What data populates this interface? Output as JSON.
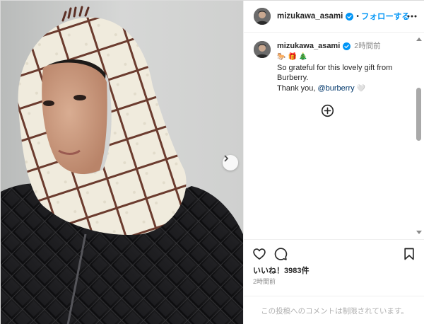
{
  "post": {
    "username": "mizukawa_asami",
    "follow_label": "フォローする",
    "separator": "•",
    "caption": {
      "emojis": [
        "🐎",
        "🎁",
        "🎄"
      ],
      "time": "2時間前",
      "line1": "So grateful for this lovely gift from",
      "line2": "Burberry.",
      "thanks": "Thank you,",
      "mention": "@burberry",
      "heart": "🤍"
    },
    "likes_text": "いいね！3983件",
    "post_time": "2時間前",
    "comments_disabled": "この投稿へのコメントは制限されています。"
  },
  "icons": {
    "verified": "verified-badge-icon",
    "more": "more-options-icon",
    "next": "chevron-right-icon",
    "load_more": "plus-circle-icon",
    "like": "heart-icon",
    "comment": "comment-icon",
    "save": "bookmark-icon"
  },
  "colors": {
    "follow_blue": "#0095f6",
    "verified_blue": "#0095f6",
    "mention": "#00376b",
    "secondary_text": "#8e8e8e"
  }
}
